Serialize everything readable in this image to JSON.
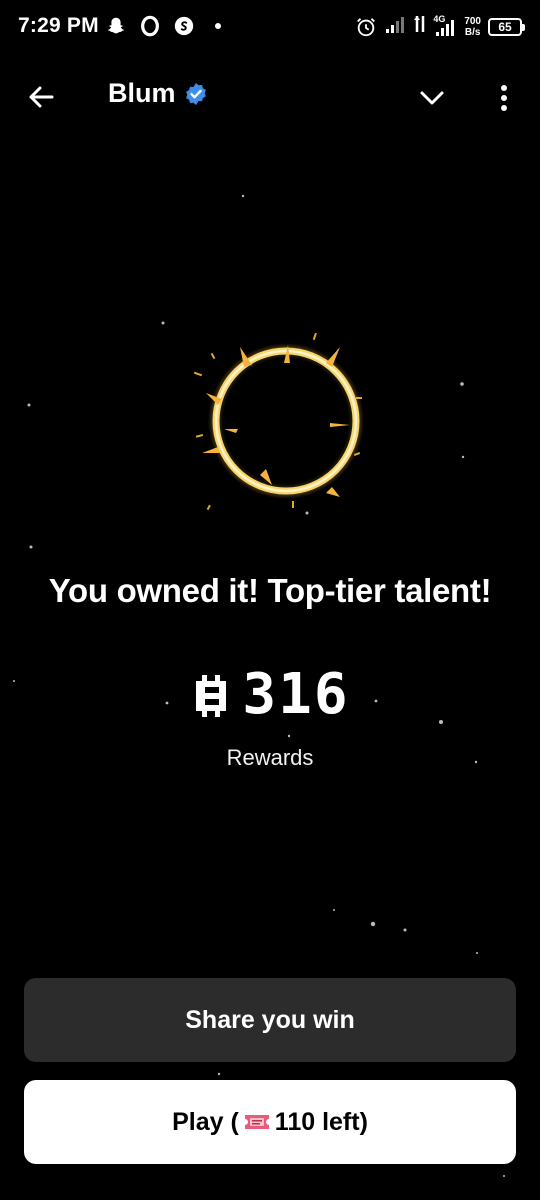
{
  "status_bar": {
    "time": "7:29 PM",
    "left_icons": [
      "snapchat-icon",
      "opera-icon",
      "shazam-icon",
      "dot-icon"
    ],
    "right_icons": [
      "alarm-icon",
      "signal-icon",
      "data-arrows-icon",
      "4g-signal-icon"
    ],
    "network_type": "4G",
    "net_speed_value": "700",
    "net_speed_unit": "B/s",
    "battery": "65"
  },
  "header": {
    "back_icon": "arrow-left-icon",
    "title": "Blum",
    "verified_icon": "verified-badge-icon",
    "chevron_icon": "chevron-down-icon",
    "menu_icon": "more-vertical-icon"
  },
  "result": {
    "headline": "You owned it! Top-tier talent!",
    "coin_icon": "blum-coin-icon",
    "reward_value": "316",
    "reward_label": "Rewards"
  },
  "actions": {
    "share_label": "Share you win",
    "play_label_prefix": "Play (",
    "ticket_icon": "ticket-icon",
    "play_label_suffix": "110 left)"
  },
  "colors": {
    "background": "#000000",
    "ring_gold": "#f6c95a",
    "verified_blue": "#3e8ee9",
    "share_button_bg": "#2c2c2c",
    "play_button_bg": "#ffffff",
    "ticket_pink": "#e85b7a"
  }
}
